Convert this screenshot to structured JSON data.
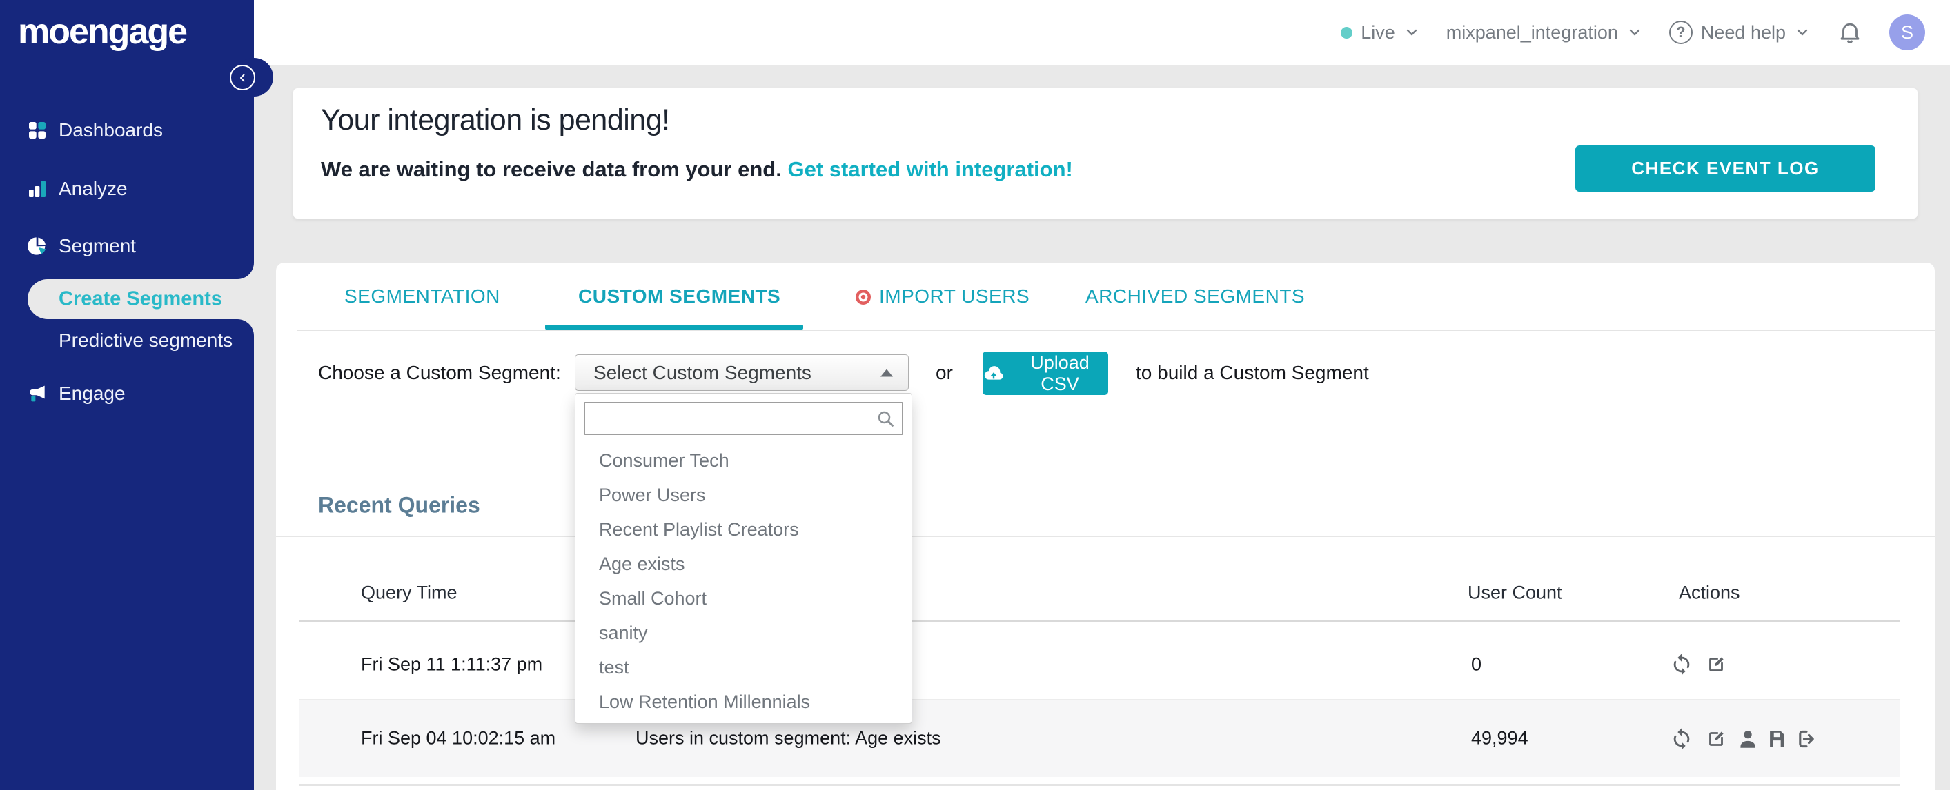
{
  "colors": {
    "navy": "#16277d",
    "teal": "#0ba6b8",
    "teal-text": "#14a4ba",
    "link": "#10afc2",
    "page-bg": "#e9e9e9",
    "heading": "#5b7d95",
    "icon-gray": "#5f6368",
    "avatar-bg": "#97a0ea"
  },
  "sidebar": {
    "logo": "moengage",
    "items": [
      "Dashboards",
      "Analyze",
      "Segment",
      "Create Segments",
      "Predictive segments",
      "Engage"
    ],
    "active_item": "Create Segments"
  },
  "topbar": {
    "env": "Live",
    "workspace": "mixpanel_integration",
    "help": "Need help",
    "avatar_initial": "S"
  },
  "banner": {
    "title": "Your integration is pending!",
    "message": "We are waiting to receive data from your end.",
    "link": "Get started with integration!",
    "button": "CHECK EVENT LOG"
  },
  "tabs": [
    "SEGMENTATION",
    "CUSTOM SEGMENTS",
    "IMPORT USERS",
    "ARCHIVED SEGMENTS"
  ],
  "active_tab": "CUSTOM SEGMENTS",
  "chooser": {
    "label": "Choose a Custom Segment:",
    "select_value": "Select Custom Segments",
    "or": "or",
    "upload_button": "Upload CSV",
    "suffix": "to build a Custom Segment",
    "search_placeholder": ""
  },
  "dropdown": {
    "items": [
      "Consumer Tech",
      "Power Users",
      "Recent Playlist Creators",
      "Age exists",
      "Small Cohort",
      "sanity",
      "test",
      "Low Retention Millennials"
    ]
  },
  "queries": {
    "heading": "Recent Queries",
    "columns": [
      "Query Time",
      "User Count",
      "Actions"
    ],
    "rows": [
      {
        "time": "Fri Sep 11 1:11:37 pm",
        "query": "",
        "count": "0",
        "actions": [
          "refresh",
          "edit"
        ]
      },
      {
        "time": "Fri Sep 04 10:02:15 am",
        "query": "Users in custom segment: Age exists",
        "count": "49,994",
        "actions": [
          "refresh",
          "edit",
          "user",
          "save",
          "export"
        ]
      }
    ]
  }
}
